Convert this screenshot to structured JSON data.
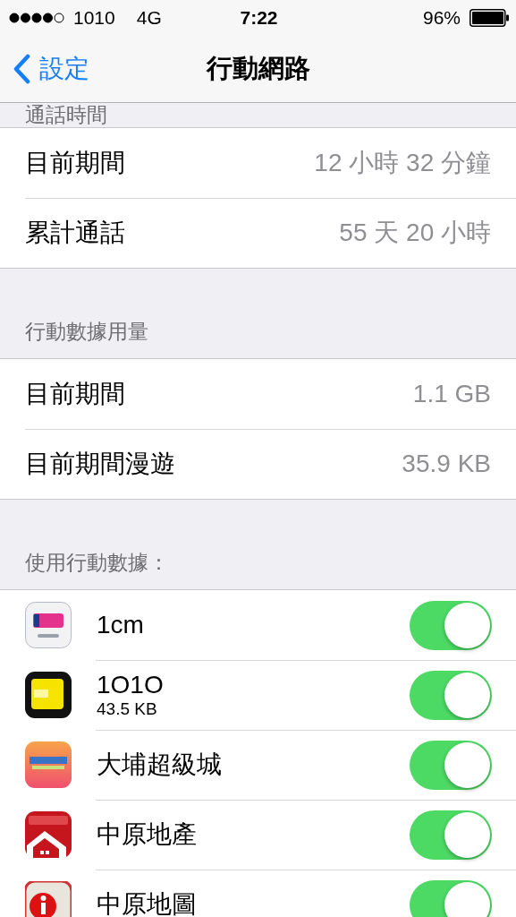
{
  "status_bar": {
    "carrier": "1010",
    "network": "4G",
    "time": "7:22",
    "battery": "96%"
  },
  "nav": {
    "back": "設定",
    "title": "行動網路"
  },
  "sections": [
    {
      "header": "通話時間",
      "rows": [
        {
          "label": "目前期間",
          "value": "12 小時 32 分鐘"
        },
        {
          "label": "累計通話",
          "value": "55 天 20 小時"
        }
      ]
    },
    {
      "header": "行動數據用量",
      "rows": [
        {
          "label": "目前期間",
          "value": "1.1 GB"
        },
        {
          "label": "目前期間漫遊",
          "value": "35.9 KB"
        }
      ]
    }
  ],
  "apps": {
    "header": "使用行動數據：",
    "items": [
      {
        "name": "1cm",
        "on": true
      },
      {
        "name": "1O1O",
        "detail": "43.5 KB",
        "on": true
      },
      {
        "name": "大埔超級城",
        "on": true
      },
      {
        "name": "中原地產",
        "on": true
      },
      {
        "name": "中原地圖",
        "on": true
      }
    ]
  }
}
